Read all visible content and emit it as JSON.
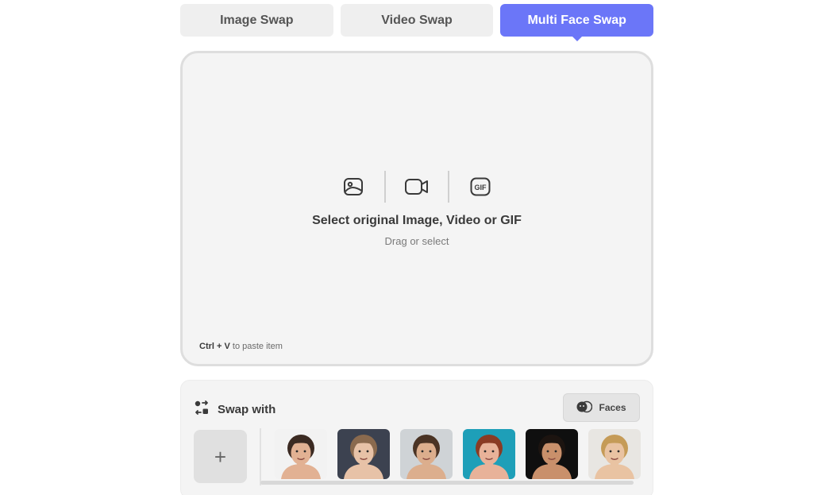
{
  "tabs": [
    {
      "label": "Image Swap",
      "active": false
    },
    {
      "label": "Video Swap",
      "active": false
    },
    {
      "label": "Multi Face Swap",
      "active": true
    }
  ],
  "upload": {
    "icons": [
      "image-icon",
      "video-camera-icon",
      "gif-icon"
    ],
    "gif_label": "GIF",
    "title": "Select original Image, Video or GIF",
    "subtitle": "Drag or select",
    "paste_shortcut": "Ctrl + V",
    "paste_text": "to paste item"
  },
  "swap": {
    "title": "Swap with",
    "faces_button_label": "Faces",
    "add_label": "+",
    "faces": [
      {
        "bg": "#f2f2f2",
        "skin": "#e2b193",
        "hair": "#3b2a22"
      },
      {
        "bg": "#3c4250",
        "skin": "#e7c2a7",
        "hair": "#8a6a4e"
      },
      {
        "bg": "#cfd3d6",
        "skin": "#dcae8d",
        "hair": "#4a3324"
      },
      {
        "bg": "#1e9fb8",
        "skin": "#e8b299",
        "hair": "#8a3b24"
      },
      {
        "bg": "#0f0f0f",
        "skin": "#c9906b",
        "hair": "#1c1410"
      },
      {
        "bg": "#e8e6e2",
        "skin": "#e9c3a2",
        "hair": "#c59b57"
      }
    ]
  },
  "colors": {
    "accent": "#6b76f8",
    "panel": "#f4f4f4",
    "tab": "#efefef"
  }
}
